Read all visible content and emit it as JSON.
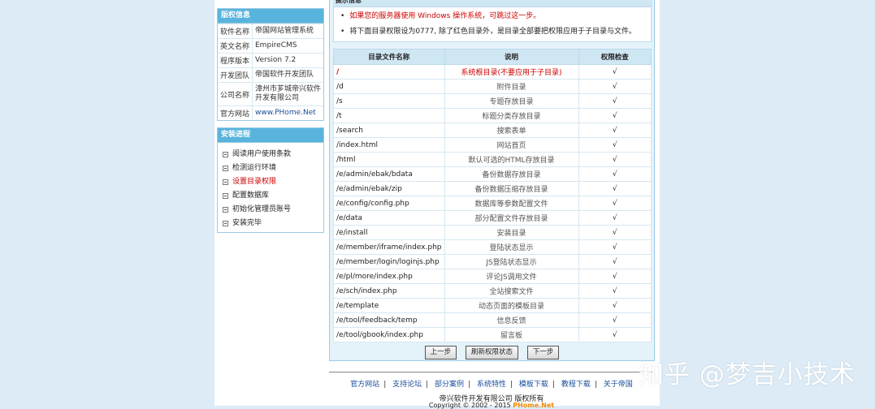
{
  "copyright_panel": {
    "title": "版权信息",
    "rows": [
      {
        "k": "软件名称",
        "v": "帝国网站管理系统"
      },
      {
        "k": "英文名称",
        "v": "EmpireCMS"
      },
      {
        "k": "程序版本",
        "v": "Version 7.2"
      },
      {
        "k": "开发团队",
        "v": "帝国软件开发团队"
      },
      {
        "k": "公司名称",
        "v": "漳州市芗城帝兴软件开发有限公司"
      },
      {
        "k": "官方网站",
        "v": "www.PHome.Net"
      }
    ]
  },
  "install_panel": {
    "title": "安装进程",
    "steps": [
      "阅读用户使用条款",
      "检测运行环境",
      "设置目录权限",
      "配置数据库",
      "初始化管理员账号",
      "安装完毕"
    ]
  },
  "notice": {
    "title": "提示信息",
    "line1": "如果您的服务器使用 Windows 操作系统，可跳过这一步。",
    "line2": "将下面目录权限设为0777, 除了红色目录外，是目录全部要把权限应用于子目录与文件。"
  },
  "dir_table": {
    "headers": [
      "目录文件名称",
      "说明",
      "权限检查"
    ],
    "rows": [
      {
        "path": "/",
        "desc": "系统根目录(不要应用于子目录)",
        "chk": "√"
      },
      {
        "path": "/d",
        "desc": "附件目录",
        "chk": "√"
      },
      {
        "path": "/s",
        "desc": "专题存放目录",
        "chk": "√"
      },
      {
        "path": "/t",
        "desc": "标题分类存放目录",
        "chk": "√"
      },
      {
        "path": "/search",
        "desc": "搜索表单",
        "chk": "√"
      },
      {
        "path": "/index.html",
        "desc": "网站首页",
        "chk": "√"
      },
      {
        "path": "/html",
        "desc": "默认可选的HTML存放目录",
        "chk": "√"
      },
      {
        "path": "/e/admin/ebak/bdata",
        "desc": "备份数据存放目录",
        "chk": "√"
      },
      {
        "path": "/e/admin/ebak/zip",
        "desc": "备份数据压缩存放目录",
        "chk": "√"
      },
      {
        "path": "/e/config/config.php",
        "desc": "数据库等参数配置文件",
        "chk": "√"
      },
      {
        "path": "/e/data",
        "desc": "部分配置文件存放目录",
        "chk": "√"
      },
      {
        "path": "/e/install",
        "desc": "安装目录",
        "chk": "√"
      },
      {
        "path": "/e/member/iframe/index.php",
        "desc": "登陆状态显示",
        "chk": "√"
      },
      {
        "path": "/e/member/login/loginjs.php",
        "desc": "JS登陆状态显示",
        "chk": "√"
      },
      {
        "path": "/e/pl/more/index.php",
        "desc": "评论JS调用文件",
        "chk": "√"
      },
      {
        "path": "/e/sch/index.php",
        "desc": "全站搜索文件",
        "chk": "√"
      },
      {
        "path": "/e/template",
        "desc": "动态页面的模板目录",
        "chk": "√"
      },
      {
        "path": "/e/tool/feedback/temp",
        "desc": "信息反馈",
        "chk": "√"
      },
      {
        "path": "/e/tool/gbook/index.php",
        "desc": "留言板",
        "chk": "√"
      }
    ]
  },
  "buttons": {
    "prev": "上一步",
    "refresh": "刷新权限状态",
    "next": "下一步"
  },
  "footer": {
    "links": [
      "官方网站",
      "支持论坛",
      "部分案例",
      "系统特性",
      "模板下载",
      "教程下载",
      "关于帝国"
    ],
    "copy1": "帝兴软件开发有限公司 版权所有",
    "copy2_prefix": "Copyright © 2002 - 2015 ",
    "copy2_brand": "PHome.Net"
  },
  "watermark": "知乎 @梦吉小技术",
  "colors": {
    "accent": "#58b4dc",
    "background": "#dcebf6",
    "warning": "#cc0000"
  }
}
